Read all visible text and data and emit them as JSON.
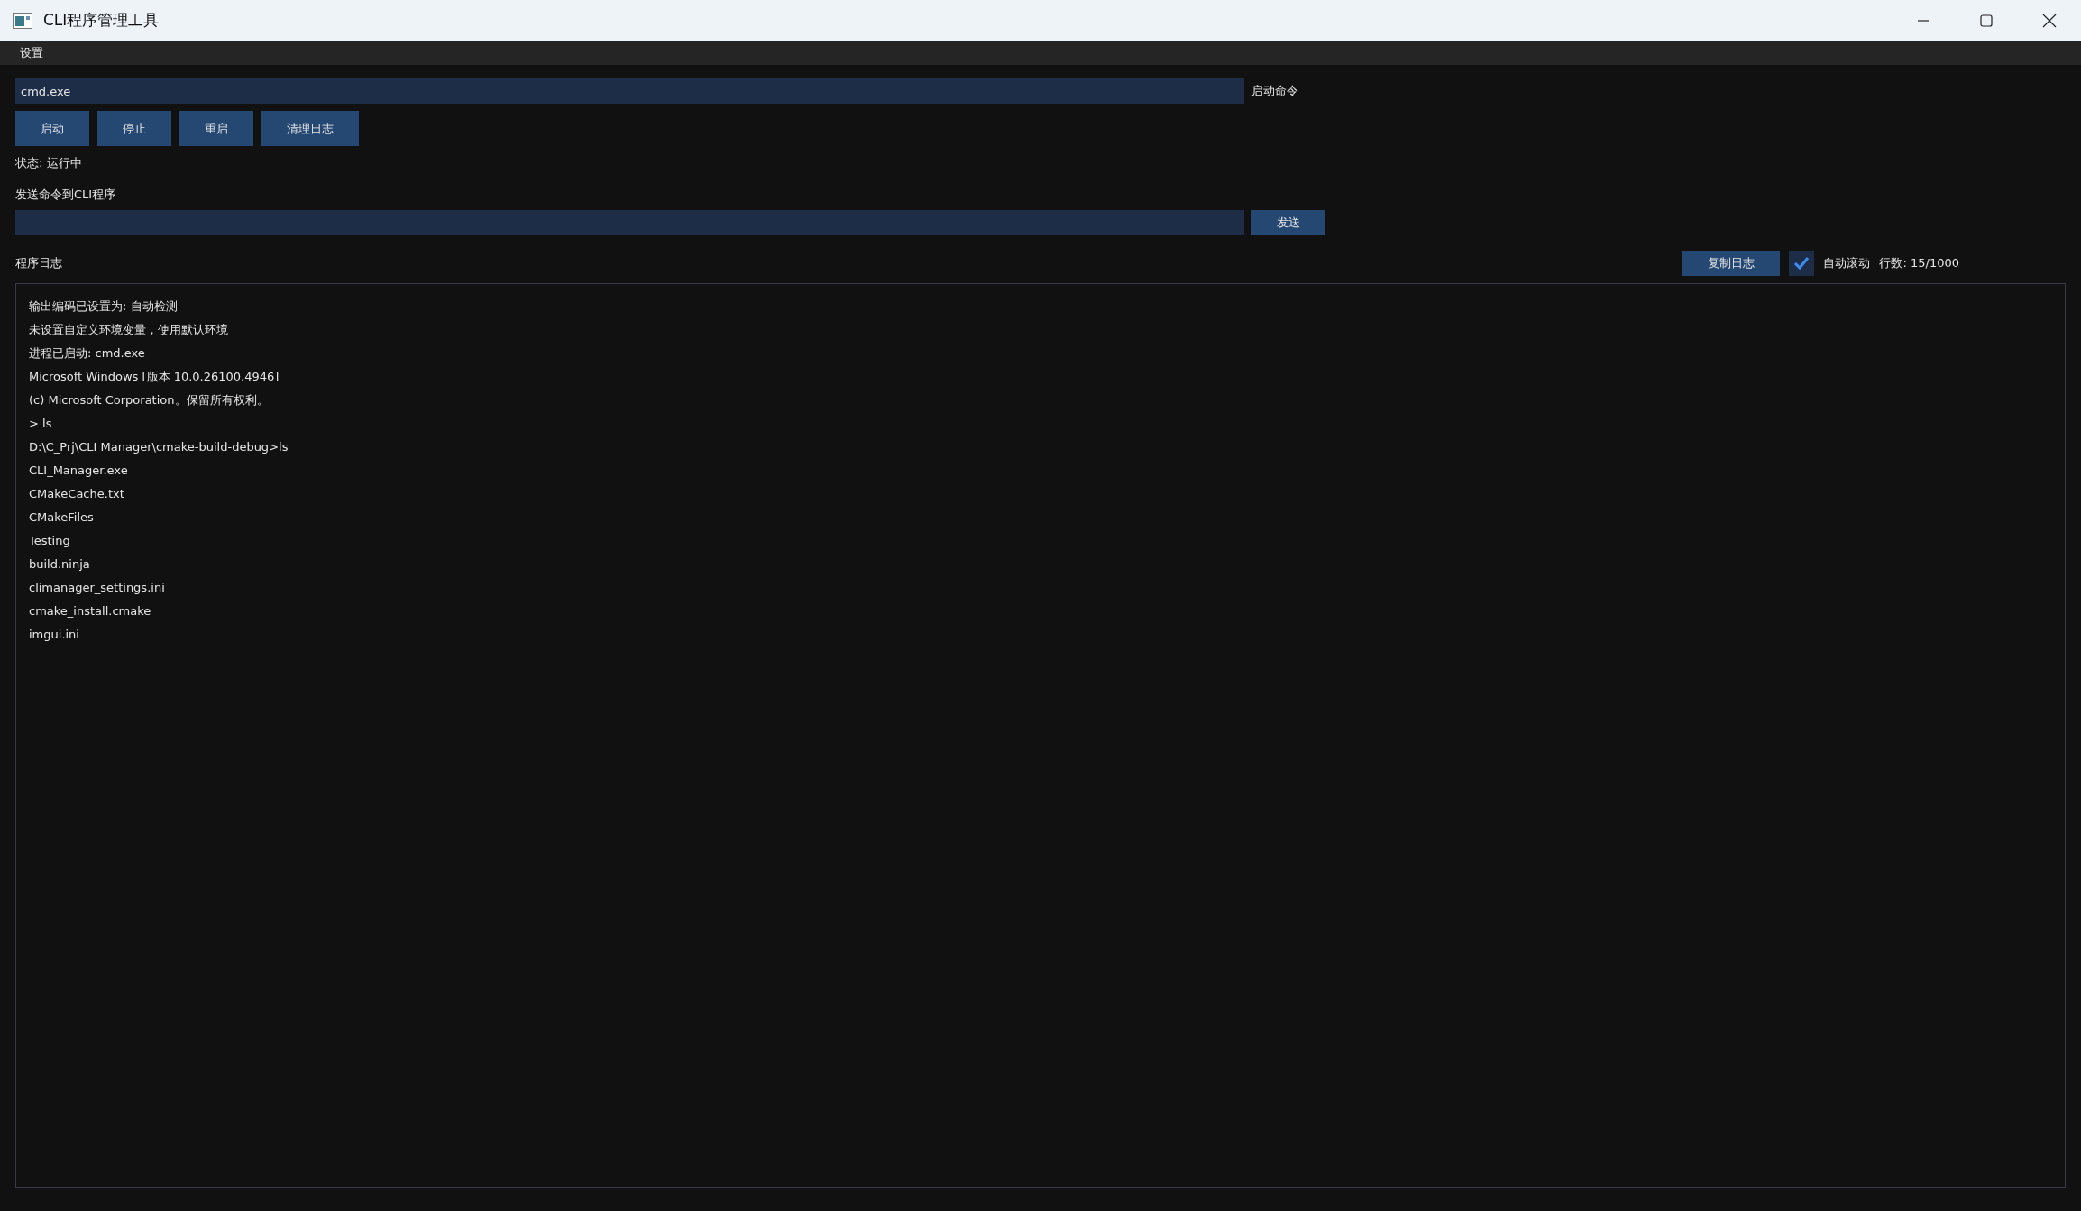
{
  "window": {
    "title": "CLI程序管理工具"
  },
  "menu": [
    "设置"
  ],
  "command": {
    "value": "cmd.exe",
    "label": "启动命令"
  },
  "buttons": [
    "启动",
    "停止",
    "重启",
    "清理日志"
  ],
  "status": "状态: 运行中",
  "send": {
    "label": "发送命令到CLI程序",
    "button": "发送"
  },
  "log": {
    "title": "程序日志",
    "copy_button": "复制日志",
    "auto_scroll": {
      "label": "自动滚动",
      "checked": true
    },
    "line_count": "行数: 15/1000",
    "lines": [
      "输出编码已设置为: 自动检测",
      "未设置自定义环境变量，使用默认环境",
      "进程已启动: cmd.exe",
      "Microsoft Windows [版本 10.0.26100.4946]",
      "(c) Microsoft Corporation。保留所有权利。",
      "> ls",
      "D:\\C_Prj\\CLI Manager\\cmake-build-debug>ls",
      "CLI_Manager.exe",
      "CMakeCache.txt",
      "CMakeFiles",
      "Testing",
      "build.ninja",
      "climanager_settings.ini",
      "cmake_install.cmake",
      "imgui.ini"
    ]
  }
}
